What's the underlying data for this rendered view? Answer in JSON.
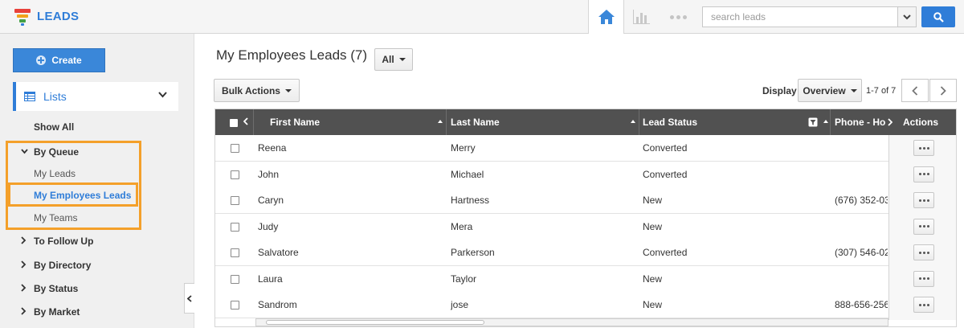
{
  "app": {
    "title": "LEADS",
    "brand_color": "#2f7dd8",
    "accent_highlight": "#f4a02a"
  },
  "topbar": {
    "icons": [
      "funnel-logo-icon",
      "home-icon",
      "bar-chart-icon",
      "more-dots-icon",
      "chevron-down-icon",
      "search-icon"
    ],
    "search": {
      "placeholder": "search leads",
      "value": ""
    }
  },
  "sidebar": {
    "create_label": "Create",
    "lists_label": "Lists",
    "items": [
      {
        "label": "Show All",
        "type": "item"
      },
      {
        "label": "By Queue",
        "type": "group",
        "expanded": true,
        "children": [
          {
            "label": "My Leads"
          },
          {
            "label": "My Employees Leads",
            "active": true
          },
          {
            "label": "My Teams"
          }
        ]
      },
      {
        "label": "To Follow Up",
        "type": "group",
        "expanded": false
      },
      {
        "label": "By Directory",
        "type": "group",
        "expanded": false
      },
      {
        "label": "By Status",
        "type": "group",
        "expanded": false
      },
      {
        "label": "By Market",
        "type": "group",
        "expanded": false
      }
    ]
  },
  "main": {
    "title": "My Employees Leads (7)",
    "filter_label": "All",
    "bulk_actions_label": "Bulk Actions",
    "display_label": "Display",
    "display_value": "Overview",
    "page_count": "1-7 of 7",
    "table": {
      "columns": [
        "First Name",
        "Last Name",
        "Lead Status",
        "Phone - Ho",
        "Actions"
      ],
      "rows": [
        {
          "first": "Reena",
          "last": "Merry",
          "status": "Converted",
          "phone": ""
        },
        {
          "first": "John",
          "last": "Michael",
          "status": "Converted",
          "phone": ""
        },
        {
          "first": "Caryn",
          "last": "Hartness",
          "status": "New",
          "phone": "(676) 352-03"
        },
        {
          "first": "Judy",
          "last": "Mera",
          "status": "New",
          "phone": ""
        },
        {
          "first": "Salvatore",
          "last": "Parkerson",
          "status": "Converted",
          "phone": "(307) 546-02"
        },
        {
          "first": "Laura",
          "last": "Taylor",
          "status": "New",
          "phone": ""
        },
        {
          "first": "Sandrom",
          "last": "jose",
          "status": "New",
          "phone": "888-656-256"
        }
      ]
    }
  }
}
